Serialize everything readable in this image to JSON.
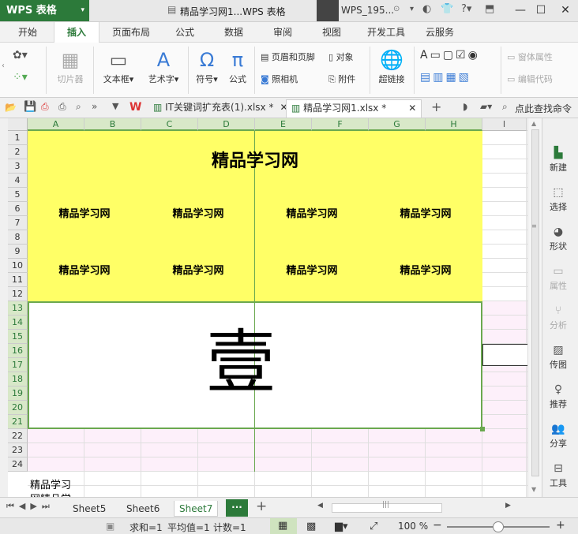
{
  "app": {
    "logo": "WPS 表格",
    "window_title": "精品学习网1...WPS 表格",
    "user": "WPS_195..."
  },
  "menu": [
    "开始",
    "插入",
    "页面布局",
    "公式",
    "数据",
    "审阅",
    "视图",
    "开发工具",
    "云服务"
  ],
  "ribbon": {
    "slicer": "切片器",
    "textbox": "文本框",
    "wordart": "艺术字",
    "symbol": "符号",
    "formula": "公式",
    "header_footer": "页眉和页脚",
    "object": "对象",
    "camera": "照相机",
    "attachment": "附件",
    "hyperlink": "超链接",
    "window_props": "窗体属性",
    "edit_code": "编辑代码"
  },
  "doc_tabs": [
    {
      "label": "IT关键词扩充表(1).xlsx *",
      "active": false
    },
    {
      "label": "精品学习网1.xlsx *",
      "active": true
    }
  ],
  "search": {
    "placeholder": "点此查找命令"
  },
  "grid": {
    "columns": [
      "A",
      "B",
      "C",
      "D",
      "E",
      "F",
      "G",
      "H",
      "I"
    ],
    "rows": [
      "1",
      "2",
      "3",
      "4",
      "5",
      "6",
      "7",
      "8",
      "9",
      "10",
      "11",
      "12",
      "13",
      "14",
      "15",
      "16",
      "17",
      "18",
      "19",
      "20",
      "21",
      "22",
      "23",
      "24"
    ],
    "title": "精品学习网",
    "cell_text": "精品学习网",
    "big_char": "壹",
    "overflow_text_1": "精品学习",
    "overflow_text_2": "网精品学"
  },
  "side_panel": [
    "新建",
    "选择",
    "形状",
    "属性",
    "分析",
    "传图",
    "推荐",
    "分享",
    "工具"
  ],
  "sheets": [
    "Sheet5",
    "Sheet6",
    "Sheet7"
  ],
  "active_sheet": "Sheet7",
  "status": {
    "sum": "求和=1",
    "avg": "平均值=1",
    "count": "计数=1",
    "zoom": "100 %"
  },
  "colors": {
    "brand": "#2c7a3a",
    "highlight": "#ffff66",
    "selection_border": "#6aa84f"
  }
}
